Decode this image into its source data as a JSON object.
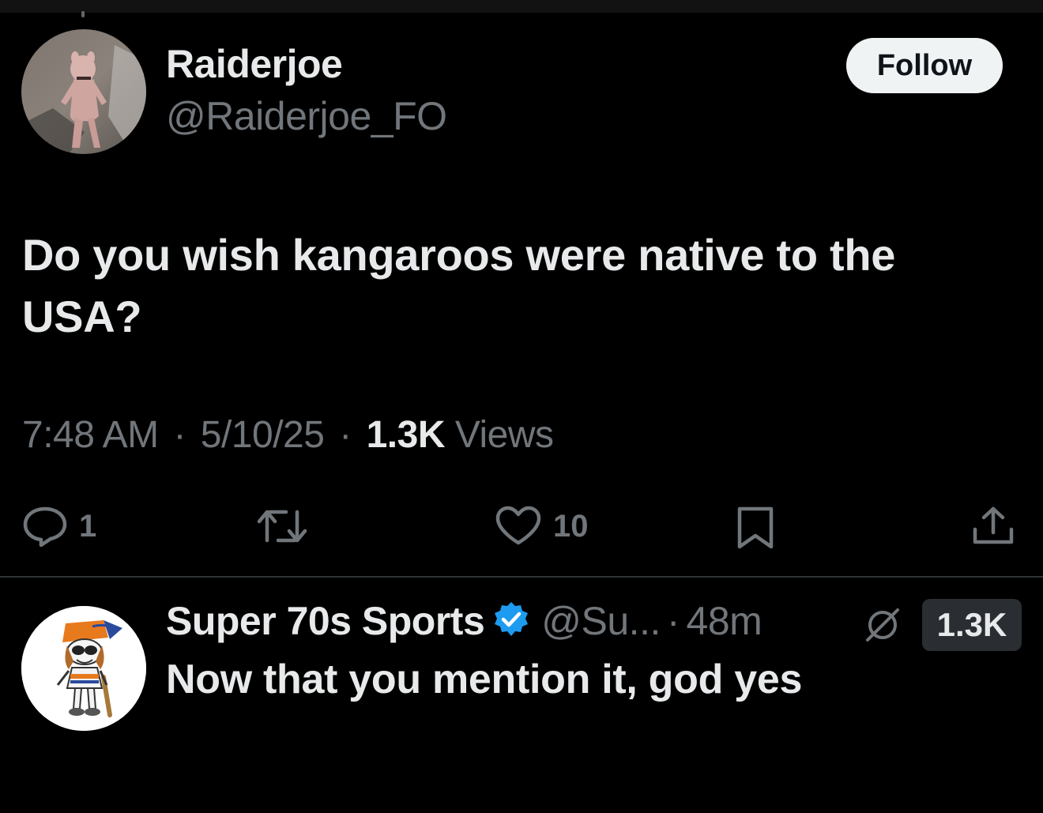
{
  "tweet": {
    "author": {
      "display_name": "Raiderjoe",
      "handle": "@Raiderjoe_FO",
      "avatar": "user-avatar-photo"
    },
    "follow_label": "Follow",
    "text": "Do you wish kangaroos were native to the USA?",
    "meta": {
      "time": "7:48 AM",
      "date": "5/10/25",
      "views_count": "1.3K",
      "views_label": "Views",
      "separator": "·"
    },
    "actions": {
      "reply": {
        "icon": "reply-icon",
        "count": "1"
      },
      "retweet": {
        "icon": "retweet-icon",
        "count": ""
      },
      "like": {
        "icon": "heart-icon",
        "count": "10"
      },
      "bookmark": {
        "icon": "bookmark-icon"
      },
      "share": {
        "icon": "share-icon"
      }
    }
  },
  "reply": {
    "author": {
      "display_name": "Super 70s Sports",
      "handle": "@Su...",
      "verified": true,
      "avatar": "super-70s-sports-logo"
    },
    "time": "48m",
    "separator": "·",
    "views_badge": "1.3K",
    "grok_icon": "grok-icon",
    "text": "Now that you mention it, god yes"
  },
  "colors": {
    "background": "#000000",
    "primary_text": "#e7e9ea",
    "secondary_text": "#71767b",
    "follow_button_bg": "#eff3f4",
    "verified_blue": "#1d9bf0",
    "divider": "#2f3336"
  }
}
